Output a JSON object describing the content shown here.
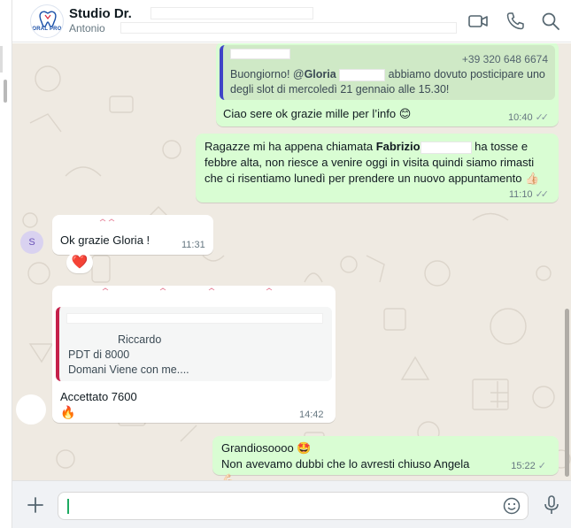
{
  "header": {
    "title": "Studio Dr.",
    "subtitle": "Antonio",
    "logo_text": "ORAL PRO",
    "icons": [
      "video-call-icon",
      "phone-icon",
      "search-icon"
    ]
  },
  "messages": [
    {
      "direction": "outgoing",
      "quote_phone": "+39 320 648 6674",
      "quote_text_1": "Buongiorno! @",
      "quote_mention": "Gloria",
      "quote_text_2": " abbiamo dovuto posticipare uno degli slot di mercoledì 21 gennaio alle 15.30!",
      "text": "Ciao sere ok grazie mille per l’info 😊",
      "time": "10:40"
    },
    {
      "direction": "outgoing",
      "text_before": "Ragazze mi ha appena chiamata ",
      "text_bold": "Fabrizio",
      "text_after": " ha tosse e febbre alta, non riesce a venire oggi in visita quindi siamo rimasti che ci risentiamo lunedì per prendere un nuovo appuntamento 👍🏻",
      "time": "11:10"
    },
    {
      "direction": "incoming",
      "avatar_letter": "S",
      "text": "Ok grazie Gloria !",
      "time": "11:31",
      "reaction": "❤️"
    },
    {
      "direction": "incoming",
      "quote_line_1": "Riccardo",
      "quote_line_2": "PDT di 8000",
      "quote_line_3": "Domani Viene con me....",
      "text": "Accettato 7600",
      "emoji": "🔥",
      "time": "14:42"
    },
    {
      "direction": "outgoing",
      "line_1": "Grandiosoooo 🤩",
      "line_2": "Non avevamo dubbi che lo avresti chiuso Angela 💪🏻",
      "time": "15:22"
    }
  ],
  "composer": {
    "placeholder": "",
    "icons": [
      "plus-icon",
      "emoji-icon",
      "microphone-icon"
    ]
  },
  "colors": {
    "outgoing_bubble": "#d9fdd3",
    "incoming_bubble": "#ffffff",
    "chat_background": "#efeae2",
    "quote_bar_blue": "#3f44c7",
    "quote_bar_red": "#c5204a",
    "accent_green": "#1daa61"
  }
}
